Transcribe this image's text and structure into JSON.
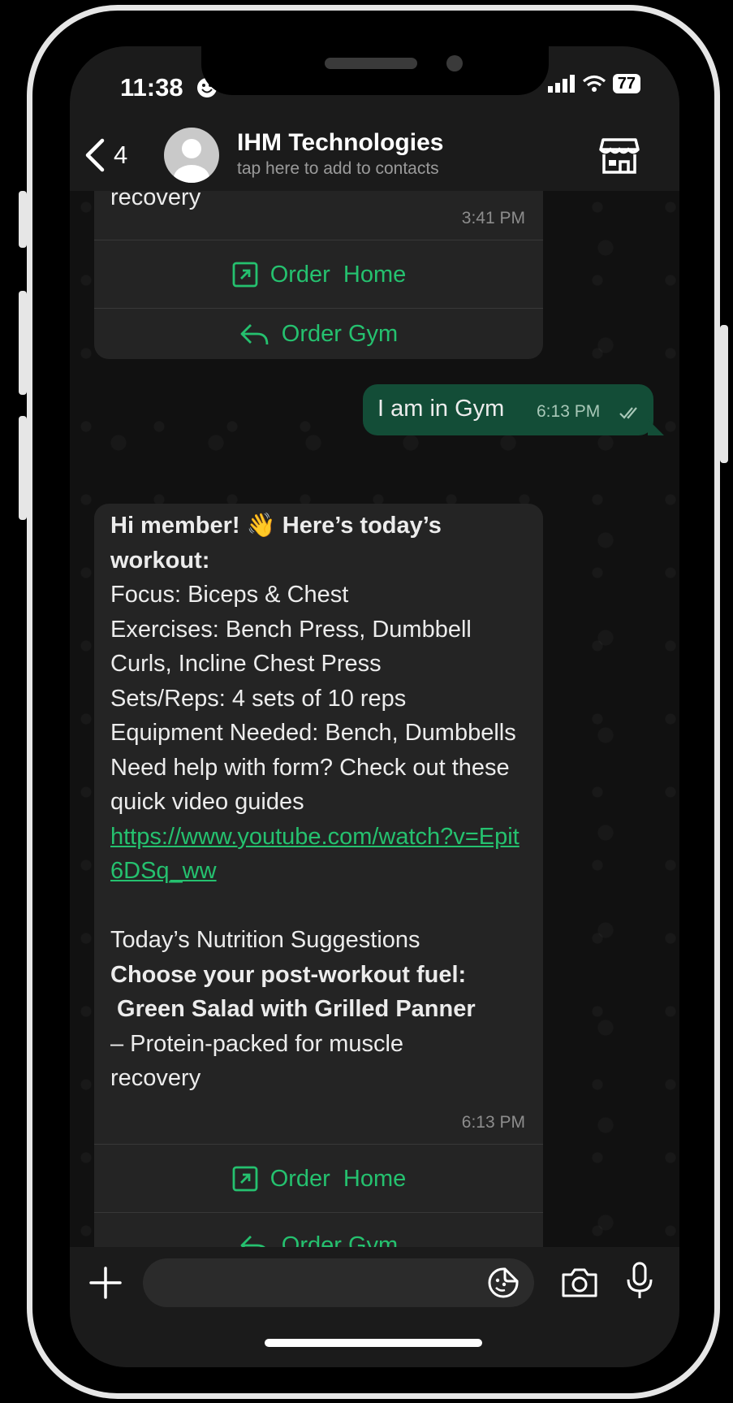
{
  "status": {
    "time": "11:38",
    "battery": "77"
  },
  "header": {
    "back_count": "4",
    "contact_name": "IHM Technologies",
    "contact_sub": "tap here to add to contacts"
  },
  "messages": {
    "first": {
      "tail_text": "recovery",
      "time": "3:41 PM",
      "btn_home": "Order  Home",
      "btn_gym": "Order Gym"
    },
    "outgoing": {
      "text": "I am in Gym",
      "time": "6:13 PM"
    },
    "second": {
      "bold_intro": "Hi member! 👋 Here’s today’s workout:",
      "line_focus": "Focus: Biceps & Chest",
      "line_exercises": "Exercises: Bench Press, Dumbbell Curls, Incline Chest Press",
      "line_sets": "Sets/Reps: 4 sets of 10 reps",
      "line_equipment": "Equipment Needed: Bench, Dumbbells",
      "line_help": "Need help with form? Check out these quick video guides",
      "link": "https://www.youtube.com/watch?v=Epit6DSq_ww",
      "line_nutrition": "Today’s Nutrition Suggestions",
      "bold_fuel": "Choose your post-workout fuel:",
      "bold_salad": " Green Salad with Grilled Panner",
      "line_protein": "– Protein-packed for muscle recovery",
      "time": "6:13 PM",
      "btn_home": "Order  Home",
      "btn_gym": "Order Gym"
    }
  },
  "colors": {
    "accent": "#25c16f",
    "outgoing_bubble": "#134d37",
    "incoming_bubble": "#242424"
  }
}
